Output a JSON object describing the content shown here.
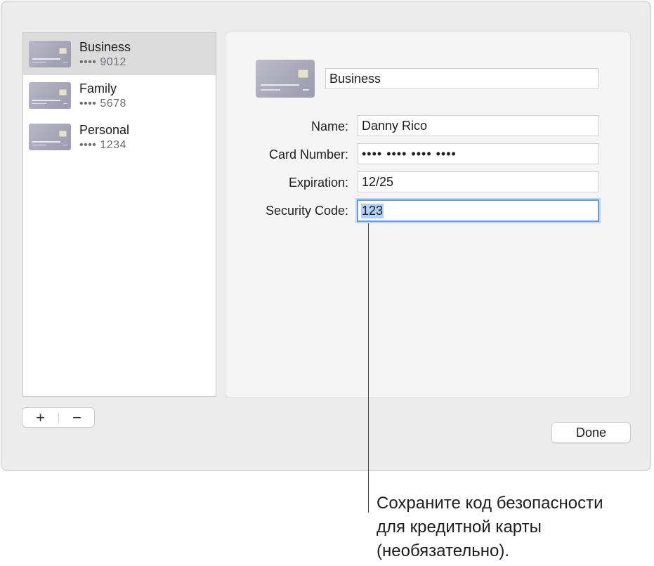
{
  "cards": [
    {
      "name": "Business",
      "digits": "•••• 9012"
    },
    {
      "name": "Family",
      "digits": "•••• 5678"
    },
    {
      "name": "Personal",
      "digits": "•••• 1234"
    }
  ],
  "list_controls": {
    "add": "+",
    "remove": "−"
  },
  "detail": {
    "card_title": "Business",
    "fields": {
      "name_label": "Name:",
      "name_value": "Danny Rico",
      "number_label": "Card Number:",
      "number_value": "•••• •••• •••• ••••",
      "expiration_label": "Expiration:",
      "expiration_value": "12/25",
      "security_label": "Security Code:",
      "security_value": "123"
    }
  },
  "done_label": "Done",
  "callout": {
    "line1": "Сохраните код безопасности",
    "line2": "для кредитной карты",
    "line3": "(необязательно)."
  },
  "colors": {
    "selection": "#b3d1f7",
    "focus_ring": "#6a9ddf",
    "selected_row": "#dcdcdc"
  }
}
